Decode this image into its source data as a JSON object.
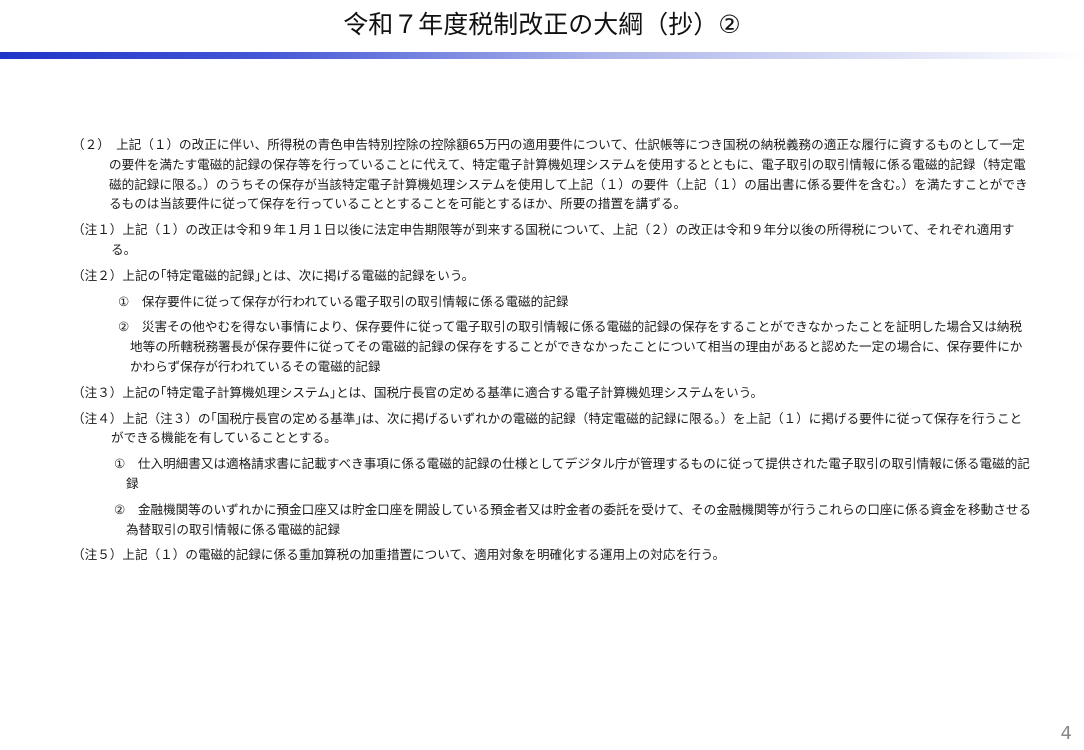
{
  "title": "令和７年度税制改正の大綱（抄）②",
  "page_number": "4",
  "accent_color": "#1f35c8",
  "paragraphs": {
    "main": "（２）　上記（１）の改正に伴い、所得税の青色申告特別控除の控除額65万円の適用要件について、仕訳帳等につき国税の納税義務の適正な履行に資するものとして一定の要件を満たす電磁的記録の保存等を行っていることに代えて、特定電子計算機処理システムを使用するとともに、電子取引の取引情報に係る電磁的記録（特定電磁的記録に限る。）のうちその保存が当該特定電子計算機処理システムを使用して上記（１）の要件（上記（１）の届出書に係る要件を含む。）を満たすことができるものは当該要件に従って保存を行っていることとすることを可能とするほか、所要の措置を講ずる。",
    "note1": "（注１）上記（１）の改正は令和９年１月１日以後に法定申告期限等が到来する国税について、上記（２）の改正は令和９年分以後の所得税について、それぞれ適用する。",
    "note2": "（注２）上記の｢特定電磁的記録｣とは、次に掲げる電磁的記録をいう。",
    "note2_item1": "①　保存要件に従って保存が行われている電子取引の取引情報に係る電磁的記録",
    "note2_item2": "②　災害その他やむを得ない事情により、保存要件に従って電子取引の取引情報に係る電磁的記録の保存をすることができなかったことを証明した場合又は納税地等の所轄税務署長が保存要件に従ってその電磁的記録の保存をすることができなかったことについて相当の理由があると認めた一定の場合に、保存要件にかかわらず保存が行われているその電磁的記録",
    "note3": "（注３）上記の｢特定電子計算機処理システム｣とは、国税庁長官の定める基準に適合する電子計算機処理システムをいう。",
    "note4": "（注４）上記（注３）の｢国税庁長官の定める基準｣は、次に掲げるいずれかの電磁的記録（特定電磁的記録に限る。）を上記（１）に掲げる要件に従って保存を行うことができる機能を有していることとする。",
    "note4_item1": "①　仕入明細書又は適格請求書に記載すべき事項に係る電磁的記録の仕様としてデジタル庁が管理するものに従って提供された電子取引の取引情報に係る電磁的記録",
    "note4_item2": "②　金融機関等のいずれかに預金口座又は貯金口座を開設している預金者又は貯金者の委託を受けて、その金融機関等が行うこれらの口座に係る資金を移動させる為替取引の取引情報に係る電磁的記録",
    "note5": "（注５）上記（１）の電磁的記録に係る重加算税の加重措置について、適用対象を明確化する運用上の対応を行う。"
  }
}
